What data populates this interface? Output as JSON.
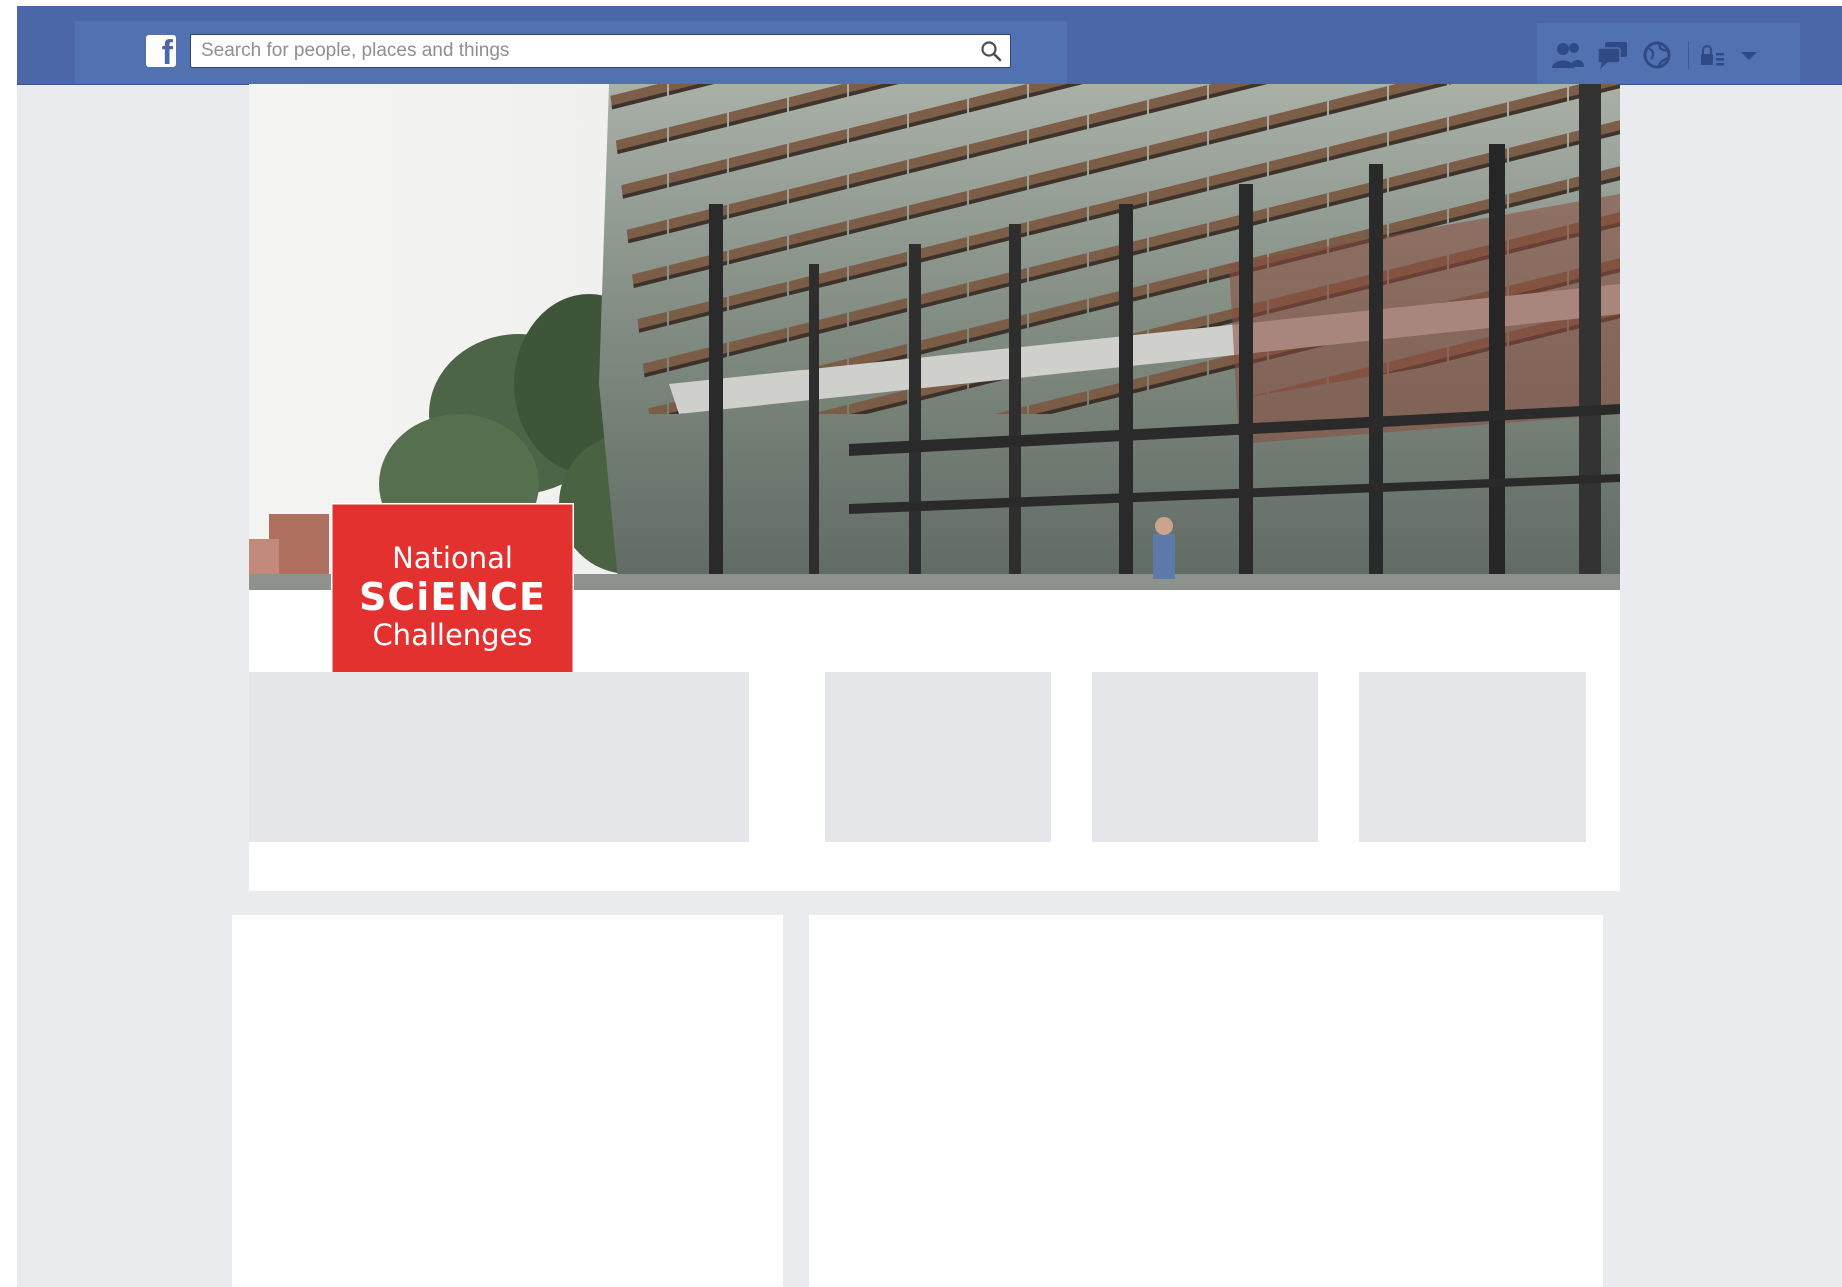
{
  "app": {
    "logo_icon": "facebook-f-icon"
  },
  "search": {
    "placeholder": "Search for people, places and things",
    "value": "",
    "icon": "search-icon"
  },
  "header_icons": [
    "friends-icon",
    "messages-icon",
    "notifications-icon",
    "privacy-icon",
    "chevron-down-icon"
  ],
  "profile": {
    "logo_lines": [
      "National",
      "SCiENCE",
      "Challenges"
    ],
    "logo_color": "#e3312f"
  },
  "colors": {
    "topbar": "#4b67a8",
    "page_background": "#e9ebee",
    "placeholder": "#e4e6ea"
  }
}
